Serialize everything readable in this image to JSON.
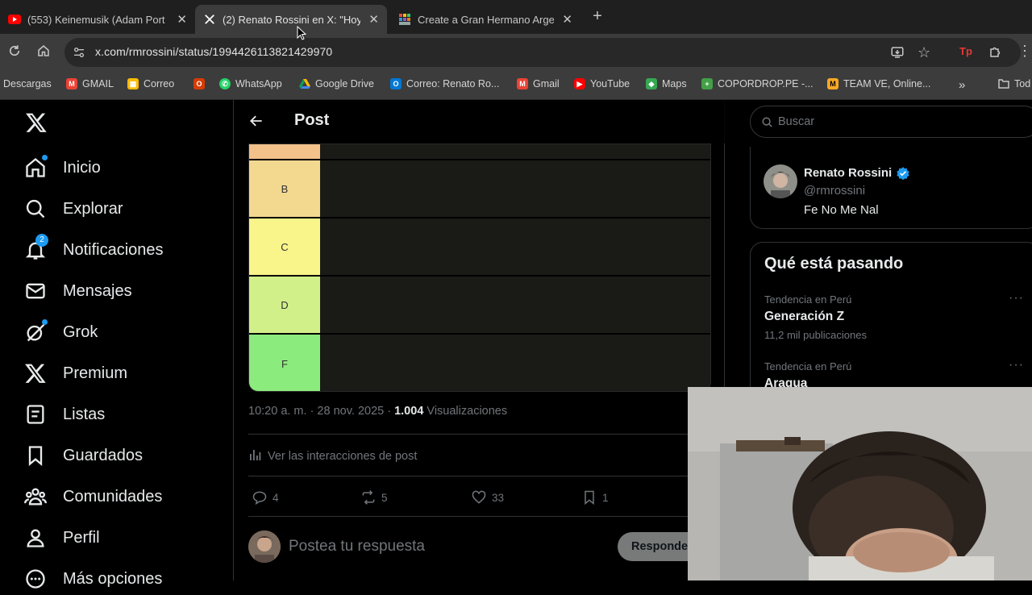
{
  "browser": {
    "tabs": [
      {
        "title": "(553) Keinemusik (Adam Port",
        "favicon": "youtube-icon"
      },
      {
        "title": "(2) Renato Rossini en X: \"Hoy",
        "favicon": "x-logo-icon"
      },
      {
        "title": "Create a Gran Hermano Argen",
        "favicon": "tiermaker-icon"
      }
    ],
    "url": "x.com/rmrossini/status/1994426113821429970",
    "bookmarks": [
      {
        "label": "Descargas",
        "color": "#3c3c3c"
      },
      {
        "label": "GMAIL",
        "color": "#ea4335"
      },
      {
        "label": "Correo",
        "color": "#fbbc04"
      },
      {
        "label": "WhatsApp",
        "color": "#25d366"
      },
      {
        "label": "Google Drive",
        "color": "#1fa463"
      },
      {
        "label": "Correo: Renato Ro...",
        "color": "#0078d4"
      },
      {
        "label": "Gmail",
        "color": "#ea4335"
      },
      {
        "label": "YouTube",
        "color": "#ff0000"
      },
      {
        "label": "Maps",
        "color": "#34a853"
      },
      {
        "label": "COPORDROP.PE -...",
        "color": "#43a047"
      },
      {
        "label": "TEAM VE, Online...",
        "color": "#f9a825"
      },
      {
        "label": "Tod",
        "color": "#c7c7c7"
      }
    ]
  },
  "nav": {
    "items": [
      {
        "label": "Inicio",
        "icon": "home-icon"
      },
      {
        "label": "Explorar",
        "icon": "search-icon"
      },
      {
        "label": "Notificaciones",
        "icon": "bell-icon",
        "badge": "2"
      },
      {
        "label": "Mensajes",
        "icon": "mail-icon"
      },
      {
        "label": "Grok",
        "icon": "grok-icon"
      },
      {
        "label": "Premium",
        "icon": "x-logo-icon"
      },
      {
        "label": "Listas",
        "icon": "list-icon"
      },
      {
        "label": "Guardados",
        "icon": "bookmark-icon"
      },
      {
        "label": "Comunidades",
        "icon": "communities-icon"
      },
      {
        "label": "Perfil",
        "icon": "person-icon"
      },
      {
        "label": "Más opciones",
        "icon": "more-circle-icon"
      }
    ],
    "accent": "#1d9bf0"
  },
  "post": {
    "header_title": "Post",
    "tiers": [
      {
        "label": "",
        "color": "#f2c28a"
      },
      {
        "label": "B",
        "color": "#f3d890"
      },
      {
        "label": "C",
        "color": "#f9f58a"
      },
      {
        "label": "D",
        "color": "#d2f08a"
      },
      {
        "label": "F",
        "color": "#8ceb7d"
      }
    ],
    "timestamp": "10:20 a. m. · 28 nov. 2025 · ",
    "views_count": "1.004",
    "views_label": "Visualizaciones",
    "interactions_label": "Ver las interacciones de post",
    "replies": "4",
    "reposts": "5",
    "likes": "33",
    "bookmarks": "1",
    "reply_placeholder": "Postea tu respuesta",
    "reply_button": "Responder"
  },
  "sidebar": {
    "search_placeholder": "Buscar",
    "profile": {
      "name": "Renato Rossini",
      "handle": "@rmrossini",
      "bio": "Fe No Me Nal"
    },
    "trends_title": "Qué está pasando",
    "trends": [
      {
        "context": "Tendencia en Perú",
        "name": "Generación Z",
        "count": "11,2 mil publicaciones"
      },
      {
        "context": "Tendencia en Perú",
        "name": "Aragua",
        "count": ""
      }
    ]
  }
}
